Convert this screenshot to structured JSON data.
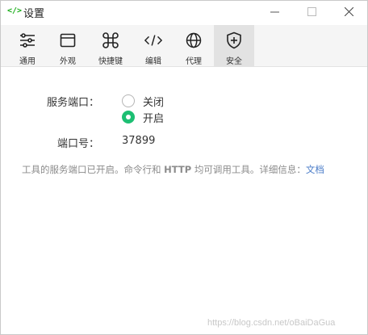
{
  "window": {
    "title": "设置"
  },
  "toolbar": {
    "tabs": [
      {
        "label": "通用",
        "icon": "sliders-icon"
      },
      {
        "label": "外观",
        "icon": "window-icon"
      },
      {
        "label": "快捷键",
        "icon": "command-icon"
      },
      {
        "label": "编辑",
        "icon": "code-icon"
      },
      {
        "label": "代理",
        "icon": "globe-icon"
      },
      {
        "label": "安全",
        "icon": "shield-plus-icon",
        "active": true
      }
    ]
  },
  "settings": {
    "service_port_label": "服务端口：",
    "option_off": "关闭",
    "option_on": "开启",
    "selected": "开启",
    "port_number_label": "端口号：",
    "port_number": "37899",
    "info_prefix": "工具的服务端口已开启。命令行和 ",
    "info_http": "HTTP",
    "info_middle": " 均可调用工具。详细信息：",
    "info_link": "文档"
  },
  "watermark": "https://blog.csdn.net/oBaiDaGua",
  "colors": {
    "accent_green": "#1dbf73",
    "link_blue": "#4a7cc8",
    "info_gray": "#8c8c8c"
  }
}
